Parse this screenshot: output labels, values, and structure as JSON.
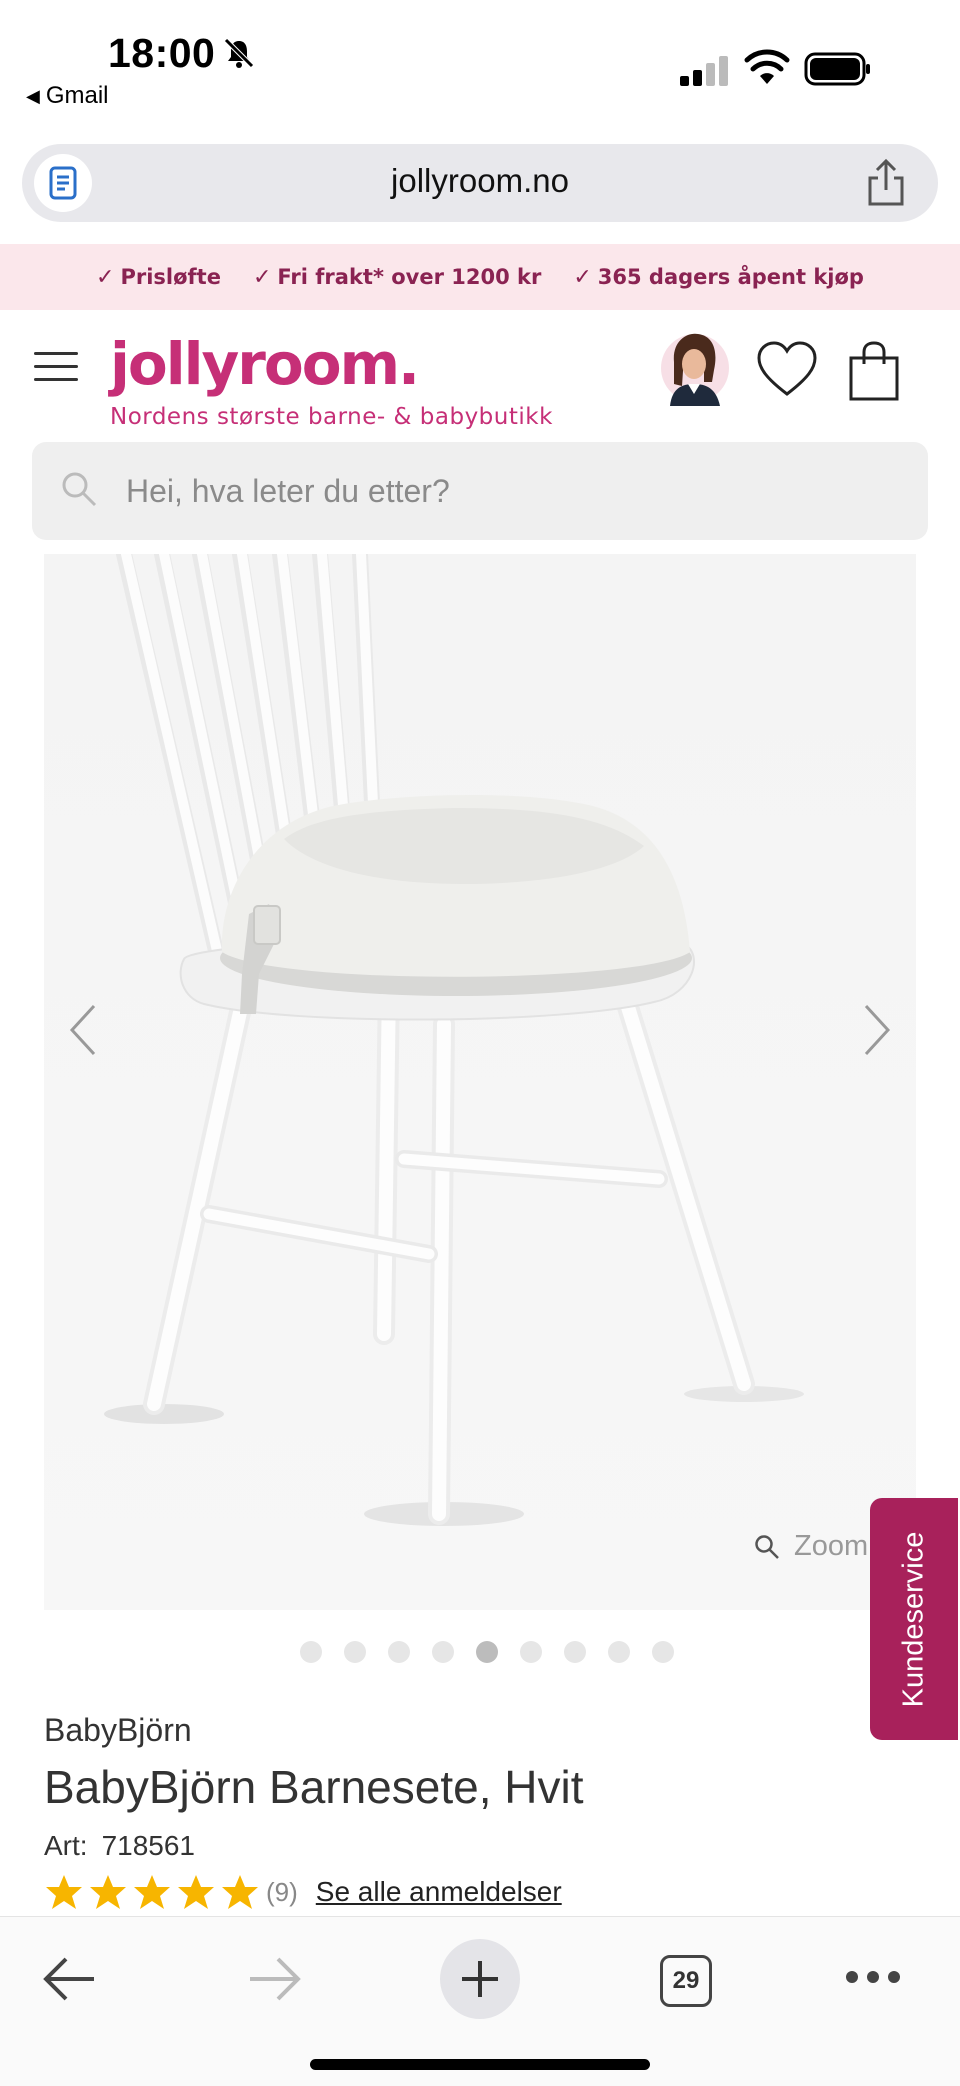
{
  "status_bar": {
    "time": "18:00",
    "back_app": "Gmail",
    "icons": [
      "bell-slash-icon",
      "signal-icon",
      "wifi-icon",
      "battery-icon"
    ]
  },
  "browser": {
    "url": "jollyroom.no",
    "icons": [
      "reader-icon",
      "share-icon"
    ]
  },
  "usp": [
    "Prisløfte",
    "Fri frakt* over 1200 kr",
    "365 dagers åpent kjøp"
  ],
  "header": {
    "logo": "jollyroom.",
    "tagline": "Nordens største barne- & babybutikk"
  },
  "search": {
    "placeholder": "Hei, hva leter du etter?"
  },
  "gallery": {
    "zoom_label": "Zoom",
    "dot_count": 9,
    "active_dot": 4
  },
  "kundeservice": "Kundeservice",
  "product": {
    "brand": "BabyBjörn",
    "title": "BabyBjörn Barnesete, Hvit",
    "art_label": "Art:",
    "art_number": "718561",
    "rating_stars": 5,
    "review_count": "(9)",
    "reviews_link": "Se alle anmeldelser"
  },
  "toolbar": {
    "tab_count": "29"
  },
  "colors": {
    "brand_pink": "#c62f77",
    "usp_bg": "#fbe7eb",
    "usp_text": "#8a2352",
    "kundeservice_bg": "#a8215b",
    "star": "#f7b500"
  }
}
